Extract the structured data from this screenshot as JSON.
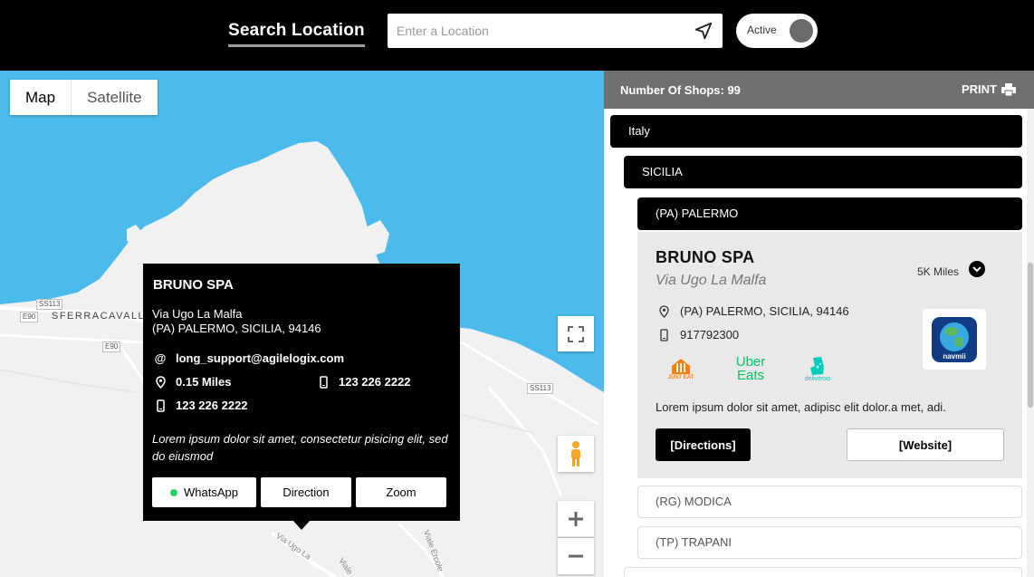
{
  "header": {
    "search_title": "Search Location",
    "search_placeholder": "Enter a Location",
    "toggle_label": "Active"
  },
  "map": {
    "type_options": [
      "Map",
      "Satellite"
    ],
    "selected_type": "Map",
    "road_labels": [
      "SS113",
      "E90",
      "E90",
      "SS113"
    ],
    "place_label": "SFERRACAVALL",
    "street_labels": [
      "Via Ugo La",
      "Viale Ercole",
      "Viale"
    ],
    "controls": [
      "fullscreen-icon",
      "pegman-icon",
      "zoom-in-icon",
      "zoom-out-icon"
    ]
  },
  "infowindow": {
    "title": "BRUNO SPA",
    "address_line1": "Via Ugo La Malfa",
    "address_line2": "(PA) PALERMO, SICILIA, 94146",
    "email": "long_support@agilelogix.com",
    "distance": "0.15 Miles",
    "phone1": "123 226 2222",
    "phone2": "123 226 2222",
    "description": "Lorem ipsum dolor sit amet, consectetur pisicing elit, sed do eiusmod",
    "buttons": {
      "whatsapp": "WhatsApp",
      "direction": "Direction",
      "zoom": "Zoom"
    }
  },
  "panel": {
    "shops_count": "Number Of Shops: 99",
    "print_label": "PRINT",
    "country": "Italy",
    "region": "SICILIA",
    "city_open": "(PA) PALERMO",
    "other_cities": [
      "(RG) MODICA",
      "(TP) TRAPANI"
    ],
    "card": {
      "name": "BRUNO SPA",
      "street": "Via Ugo La Malfa",
      "distance": "5K Miles",
      "address": "(PA) PALERMO, SICILIA, 94146",
      "phone": "917792300",
      "delivery_logos": [
        "JUST EAT",
        "Uber Eats",
        "deliveroo"
      ],
      "navmii_label": "navmii",
      "description": "Lorem ipsum dolor sit amet, adipisc elit dolor.a met, adi.",
      "directions_label": "[Directions]",
      "website_label": "[Website]"
    }
  },
  "colors": {
    "header_bg": "#000000",
    "water": "#4ABBEB",
    "land": "#F1F1F1",
    "panel_header": "#707070",
    "card_bg": "#E9E9E9",
    "deliveroo": "#00CCBC",
    "just_eat": "#FF8000",
    "uber_green": "#06C167"
  }
}
